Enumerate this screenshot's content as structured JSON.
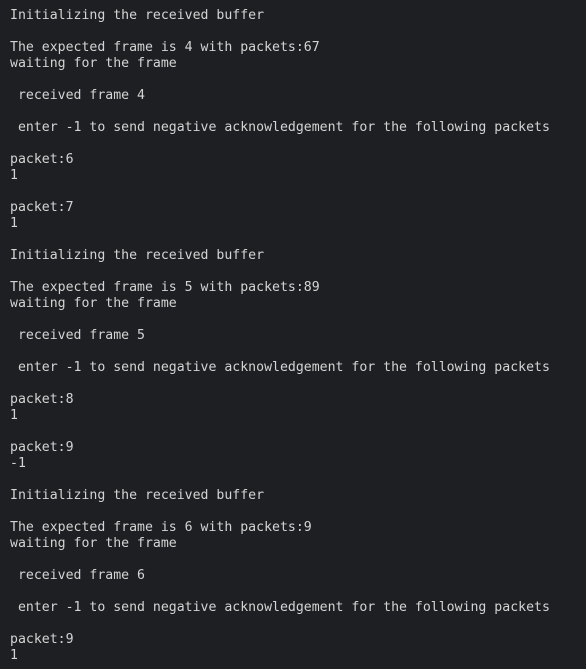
{
  "terminal": {
    "lines": [
      "Initializing the received buffer",
      "",
      "The expected frame is 4 with packets:67",
      "waiting for the frame",
      "",
      " received frame 4",
      "",
      " enter -1 to send negative acknowledgement for the following packets",
      "",
      "packet:6",
      "1",
      "",
      "packet:7",
      "1",
      "",
      "Initializing the received buffer",
      "",
      "The expected frame is 5 with packets:89",
      "waiting for the frame",
      "",
      " received frame 5",
      "",
      " enter -1 to send negative acknowledgement for the following packets",
      "",
      "packet:8",
      "1",
      "",
      "packet:9",
      "-1",
      "",
      "Initializing the received buffer",
      "",
      "The expected frame is 6 with packets:9",
      "waiting for the frame",
      "",
      " received frame 6",
      "",
      " enter -1 to send negative acknowledgement for the following packets",
      "",
      "packet:9",
      "1"
    ]
  },
  "colors": {
    "background": "#1e1f22",
    "text": "#d4d4d4"
  }
}
